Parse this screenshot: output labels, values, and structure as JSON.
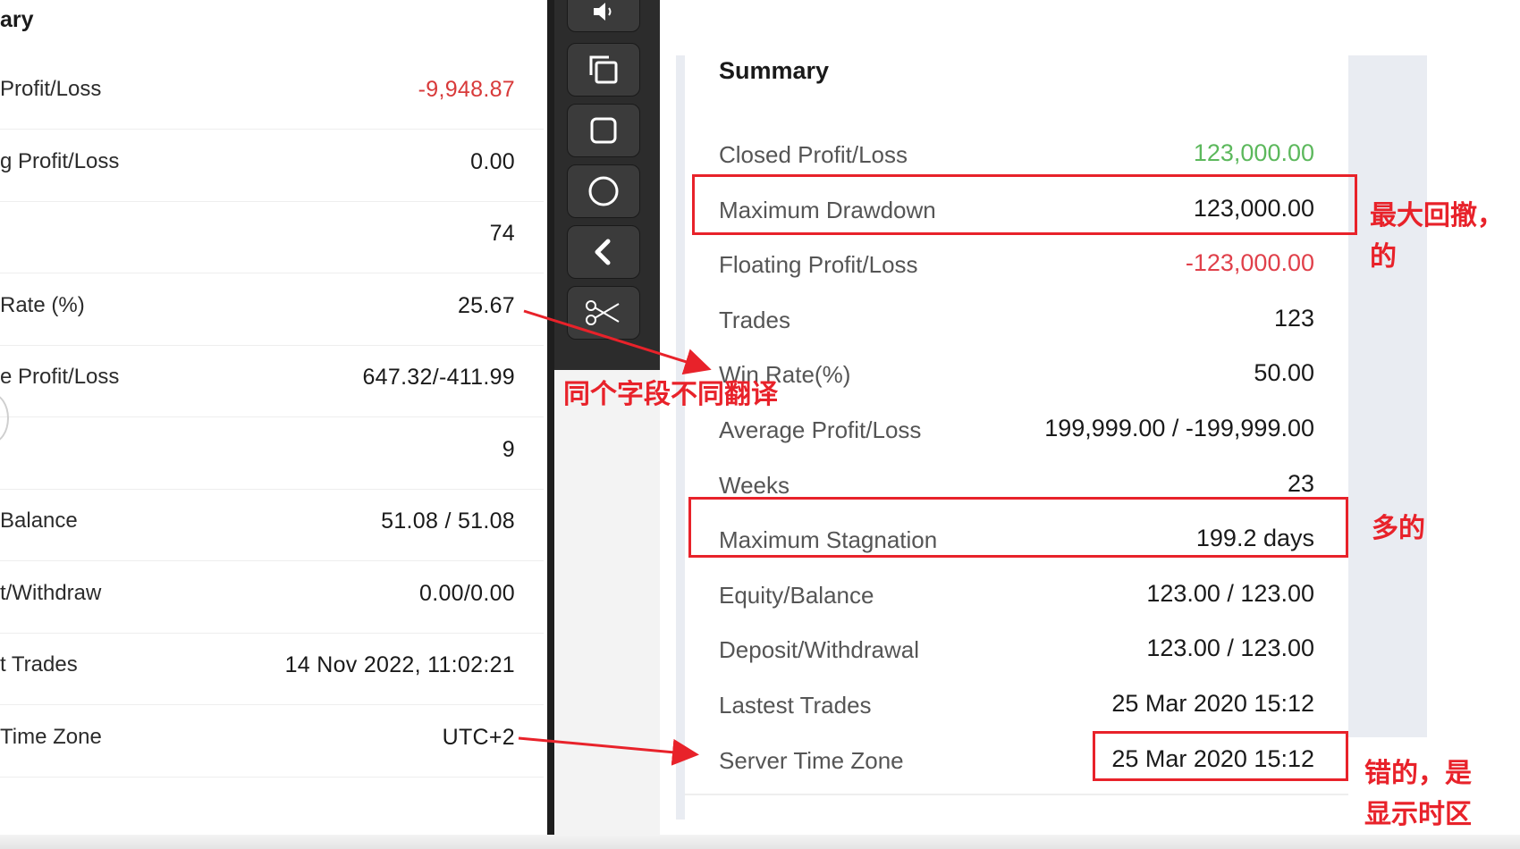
{
  "left_panel": {
    "title": "ary",
    "rows": [
      {
        "label": " Profit/Loss",
        "value": "-9,948.87",
        "negative": true
      },
      {
        "label": "g Profit/Loss",
        "value": "0.00"
      },
      {
        "label": "",
        "value": "74"
      },
      {
        "label": "Rate (%)",
        "value": "25.67"
      },
      {
        "label": "e Profit/Loss",
        "value": "647.32/-411.99"
      },
      {
        "label": "",
        "value": "9"
      },
      {
        "label": " Balance",
        "value": "51.08 / 51.08"
      },
      {
        "label": "t/Withdraw",
        "value": "0.00/0.00"
      },
      {
        "label": "t Trades",
        "value": "14 Nov 2022, 11:02:21"
      },
      {
        "label": " Time Zone",
        "value": "UTC+2"
      }
    ]
  },
  "toolbar": {
    "buttons": [
      {
        "name": "volume-icon"
      },
      {
        "name": "copy-icon"
      },
      {
        "name": "square-icon"
      },
      {
        "name": "circle-icon"
      },
      {
        "name": "chevron-left-icon"
      },
      {
        "name": "scissors-icon"
      }
    ]
  },
  "summary": {
    "title": "Summary",
    "rows": [
      {
        "label": "Closed Profit/Loss",
        "value": "123,000.00",
        "tone": "positive"
      },
      {
        "label": "Maximum Drawdown",
        "value": "123,000.00",
        "tone": "normal"
      },
      {
        "label": "Floating Profit/Loss",
        "value": "-123,000.00",
        "tone": "negative"
      },
      {
        "label": "Trades",
        "value": "123",
        "tone": "normal"
      },
      {
        "label": "Win Rate(%)",
        "value": "50.00",
        "tone": "normal"
      },
      {
        "label": "Average Profit/Loss",
        "value": "199,999.00 / -199,999.00",
        "tone": "normal"
      },
      {
        "label": "Weeks",
        "value": "23",
        "tone": "normal"
      },
      {
        "label": "Maximum Stagnation",
        "value": "199.2 days",
        "tone": "normal"
      },
      {
        "label": "Equity/Balance",
        "value": "123.00 / 123.00",
        "tone": "normal"
      },
      {
        "label": "Deposit/Withdrawal",
        "value": "123.00 / 123.00",
        "tone": "normal"
      },
      {
        "label": "Lastest Trades",
        "value": "25 Mar 2020 15:12",
        "tone": "normal"
      },
      {
        "label": "Server Time Zone",
        "value": "25 Mar 2020 15:12",
        "tone": "normal"
      }
    ]
  },
  "annotations": {
    "translation_note": "同个字段不同翻译",
    "drawdown_note_line1": "最大回撤，",
    "drawdown_note_line2": "的",
    "stagnation_note": "多的",
    "timezone_note_line1": "错的，是",
    "timezone_note_line2": "显示时区"
  },
  "colors": {
    "positive": "#5cb85c",
    "negative": "#e0404a",
    "annotation_red": "#e8222a",
    "toolbar_bg": "#2c2c2c"
  }
}
